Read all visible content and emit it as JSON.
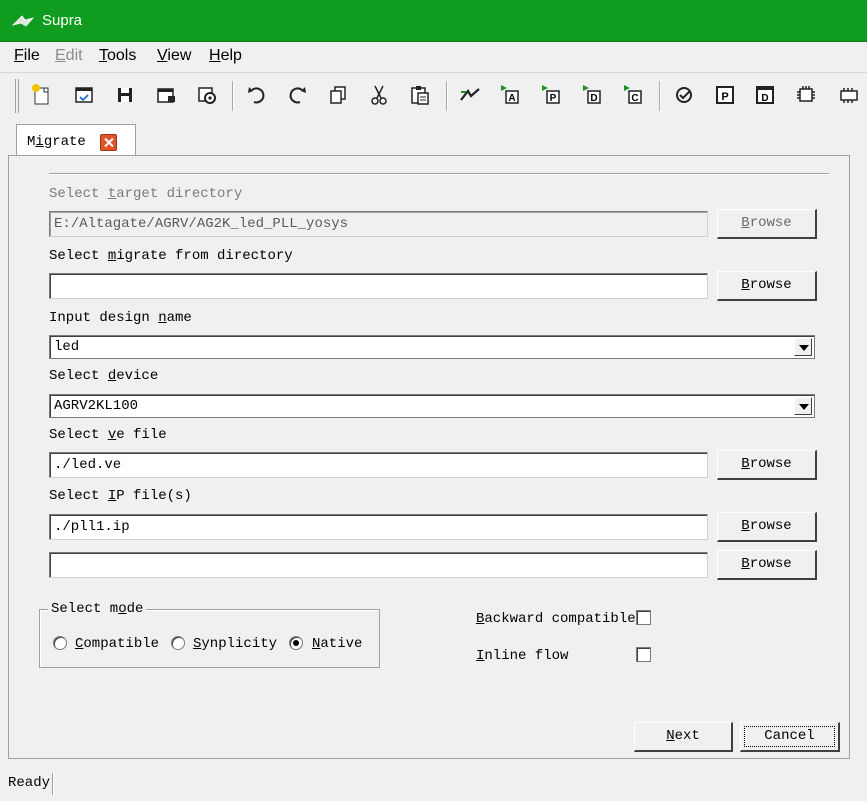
{
  "window": {
    "title": "Supra",
    "app_icon": "supra-logo-icon"
  },
  "menu": {
    "file": {
      "key": "F",
      "rest": "ile"
    },
    "edit": {
      "key": "E",
      "rest": "dit",
      "disabled": true
    },
    "tools": {
      "key": "T",
      "rest": "ools"
    },
    "view": {
      "key": "V",
      "rest": "iew"
    },
    "help": {
      "key": "H",
      "rest": "elp"
    }
  },
  "toolbar": {
    "icons": [
      "new-project-icon",
      "open-project-icon",
      "save-icon",
      "save-as-icon",
      "settings-icon",
      "undo-icon",
      "redo-icon",
      "copy-icon",
      "cut-icon",
      "paste-icon",
      "compile-icon",
      "run-a-icon",
      "run-p-icon",
      "run-d-icon",
      "run-c-icon",
      "check-icon",
      "p-panel-icon",
      "d-panel-icon",
      "chip-icon",
      "more-icon"
    ]
  },
  "tab": {
    "pre": "M",
    "key": "i",
    "post": "grate",
    "close_icon": "close-icon"
  },
  "form": {
    "target_dir": {
      "pre": "Select ",
      "key": "t",
      "post": "arget directory",
      "value": "E:/Altagate/AGRV/AG2K_led_PLL_yosys",
      "disabled": true
    },
    "migrate_dir": {
      "pre": "Select ",
      "key": "m",
      "post": "igrate from directory",
      "value": ""
    },
    "design_name": {
      "pre": "Input design ",
      "key": "n",
      "post": "ame",
      "value": "led"
    },
    "device": {
      "pre": "Select ",
      "key": "d",
      "post": "evice",
      "value": "AGRV2KL100"
    },
    "ve_file": {
      "pre": "Select ",
      "key": "v",
      "post": "e file",
      "value": "./led.ve"
    },
    "ip_files": {
      "pre": "Select ",
      "key": "I",
      "post": "P file(s)",
      "value1": "./pll1.ip",
      "value2": ""
    },
    "browse": {
      "key": "B",
      "rest": "rowse"
    }
  },
  "mode": {
    "legend_pre": "Select m",
    "legend_key": "o",
    "legend_post": "de",
    "compatible": {
      "key": "C",
      "rest": "ompatible",
      "checked": false
    },
    "synplicity": {
      "key": "S",
      "rest": "ynplicity",
      "checked": false
    },
    "native": {
      "key": "N",
      "rest": "ative",
      "checked": true
    }
  },
  "options": {
    "backward": {
      "key": "B",
      "rest": "ackward compatible",
      "checked": false
    },
    "inline": {
      "key": "I",
      "rest": "nline flow",
      "checked": false
    }
  },
  "buttons": {
    "next": {
      "key": "N",
      "rest": "ext"
    },
    "cancel": {
      "label": "Cancel"
    }
  },
  "status": {
    "text": "Ready"
  },
  "colors": {
    "titlebar": "#109c1e",
    "close": "#e0532a",
    "toolbar_green": "#1f8f2a"
  }
}
